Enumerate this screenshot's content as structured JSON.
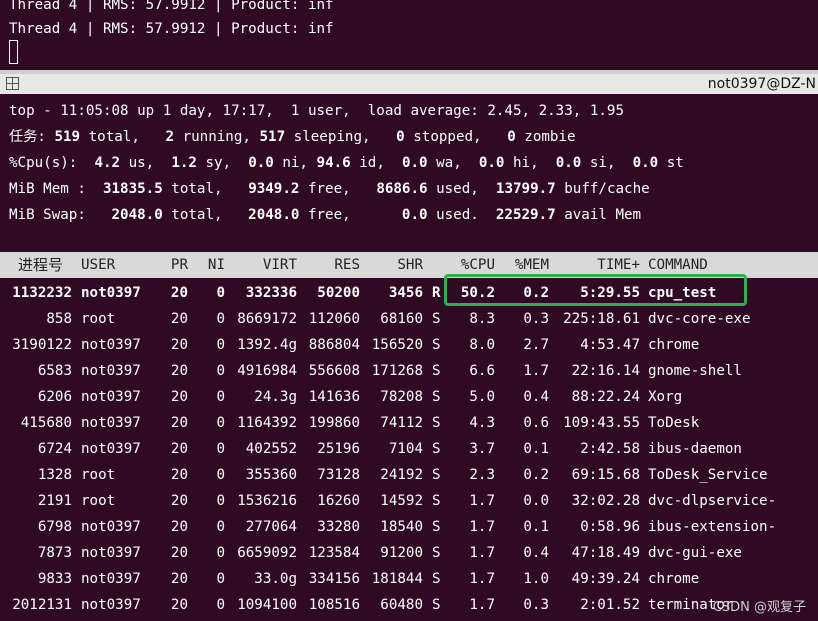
{
  "upper_terminal": {
    "line1": "Thread 4 | RMS: 57.9912 | Product: inf",
    "line2": "Thread 4 | RMS: 57.9912 | Product: inf"
  },
  "titlebar": {
    "icon": "split-terminal-icon",
    "user": "not0397@DZ-N"
  },
  "summary": {
    "top_line": "top - 11:05:08 up 1 day, 17:17,  1 user,  load average: 2.45, 2.33, 1.95",
    "tasks_label": "任务:",
    "tasks_total": "519",
    "tasks_running": "2",
    "tasks_sleeping": "517",
    "tasks_stopped": "0",
    "tasks_zombie": "0",
    "cpu_label": "%Cpu(s):",
    "cpu_us": "4.2",
    "cpu_sy": "1.2",
    "cpu_ni": "0.0",
    "cpu_id": "94.6",
    "cpu_wa": "0.0",
    "cpu_hi": "0.0",
    "cpu_si": "0.0",
    "cpu_st": "0.0",
    "mem_label": "MiB Mem :",
    "mem_total": "31835.5",
    "mem_free": "9349.2",
    "mem_used": "8686.6",
    "mem_buff": "13799.7",
    "swap_label": "MiB Swap:",
    "swap_total": "2048.0",
    "swap_free": "2048.0",
    "swap_used": "0.0",
    "swap_avail": "22529.7"
  },
  "columns": [
    "进程号",
    "USER",
    "PR",
    "NI",
    "VIRT",
    "RES",
    "SHR",
    "",
    "%CPU",
    "%MEM",
    "TIME+",
    "COMMAND"
  ],
  "processes": [
    {
      "pid": "1132232",
      "user": "not0397",
      "pr": "20",
      "ni": "0",
      "virt": "332336",
      "res": "50200",
      "shr": "3456",
      "s": "R",
      "cpu": "50.2",
      "mem": "0.2",
      "time": "5:29.55",
      "cmd": "cpu_test"
    },
    {
      "pid": "858",
      "user": "root",
      "pr": "20",
      "ni": "0",
      "virt": "8669172",
      "res": "112060",
      "shr": "68160",
      "s": "S",
      "cpu": "8.3",
      "mem": "0.3",
      "time": "225:18.61",
      "cmd": "dvc-core-exe"
    },
    {
      "pid": "3190122",
      "user": "not0397",
      "pr": "20",
      "ni": "0",
      "virt": "1392.4g",
      "res": "886804",
      "shr": "156520",
      "s": "S",
      "cpu": "8.0",
      "mem": "2.7",
      "time": "4:53.47",
      "cmd": "chrome"
    },
    {
      "pid": "6583",
      "user": "not0397",
      "pr": "20",
      "ni": "0",
      "virt": "4916984",
      "res": "556608",
      "shr": "171268",
      "s": "S",
      "cpu": "6.6",
      "mem": "1.7",
      "time": "22:16.14",
      "cmd": "gnome-shell"
    },
    {
      "pid": "6206",
      "user": "not0397",
      "pr": "20",
      "ni": "0",
      "virt": "24.3g",
      "res": "141636",
      "shr": "78208",
      "s": "S",
      "cpu": "5.0",
      "mem": "0.4",
      "time": "88:22.24",
      "cmd": "Xorg"
    },
    {
      "pid": "415680",
      "user": "not0397",
      "pr": "20",
      "ni": "0",
      "virt": "1164392",
      "res": "199860",
      "shr": "74112",
      "s": "S",
      "cpu": "4.3",
      "mem": "0.6",
      "time": "109:43.55",
      "cmd": "ToDesk"
    },
    {
      "pid": "6724",
      "user": "not0397",
      "pr": "20",
      "ni": "0",
      "virt": "402552",
      "res": "25196",
      "shr": "7104",
      "s": "S",
      "cpu": "3.7",
      "mem": "0.1",
      "time": "2:42.58",
      "cmd": "ibus-daemon"
    },
    {
      "pid": "1328",
      "user": "root",
      "pr": "20",
      "ni": "0",
      "virt": "355360",
      "res": "73128",
      "shr": "24192",
      "s": "S",
      "cpu": "2.3",
      "mem": "0.2",
      "time": "69:15.68",
      "cmd": "ToDesk_Service"
    },
    {
      "pid": "2191",
      "user": "root",
      "pr": "20",
      "ni": "0",
      "virt": "1536216",
      "res": "16260",
      "shr": "14592",
      "s": "S",
      "cpu": "1.7",
      "mem": "0.0",
      "time": "32:02.28",
      "cmd": "dvc-dlpservice-"
    },
    {
      "pid": "6798",
      "user": "not0397",
      "pr": "20",
      "ni": "0",
      "virt": "277064",
      "res": "33280",
      "shr": "18540",
      "s": "S",
      "cpu": "1.7",
      "mem": "0.1",
      "time": "0:58.96",
      "cmd": "ibus-extension-"
    },
    {
      "pid": "7873",
      "user": "not0397",
      "pr": "20",
      "ni": "0",
      "virt": "6659092",
      "res": "123584",
      "shr": "91200",
      "s": "S",
      "cpu": "1.7",
      "mem": "0.4",
      "time": "47:18.49",
      "cmd": "dvc-gui-exe"
    },
    {
      "pid": "9833",
      "user": "not0397",
      "pr": "20",
      "ni": "0",
      "virt": "33.0g",
      "res": "334156",
      "shr": "181844",
      "s": "S",
      "cpu": "1.7",
      "mem": "1.0",
      "time": "49:39.24",
      "cmd": "chrome"
    },
    {
      "pid": "2012131",
      "user": "not0397",
      "pr": "20",
      "ni": "0",
      "virt": "1094100",
      "res": "108516",
      "shr": "60480",
      "s": "S",
      "cpu": "1.7",
      "mem": "0.3",
      "time": "2:01.52",
      "cmd": "terminator"
    }
  ],
  "watermark": "CSDN @观复子",
  "colors": {
    "terminal_bg": "#300a24",
    "highlight": "#2db14d",
    "header_bg": "#d9d9d9"
  }
}
